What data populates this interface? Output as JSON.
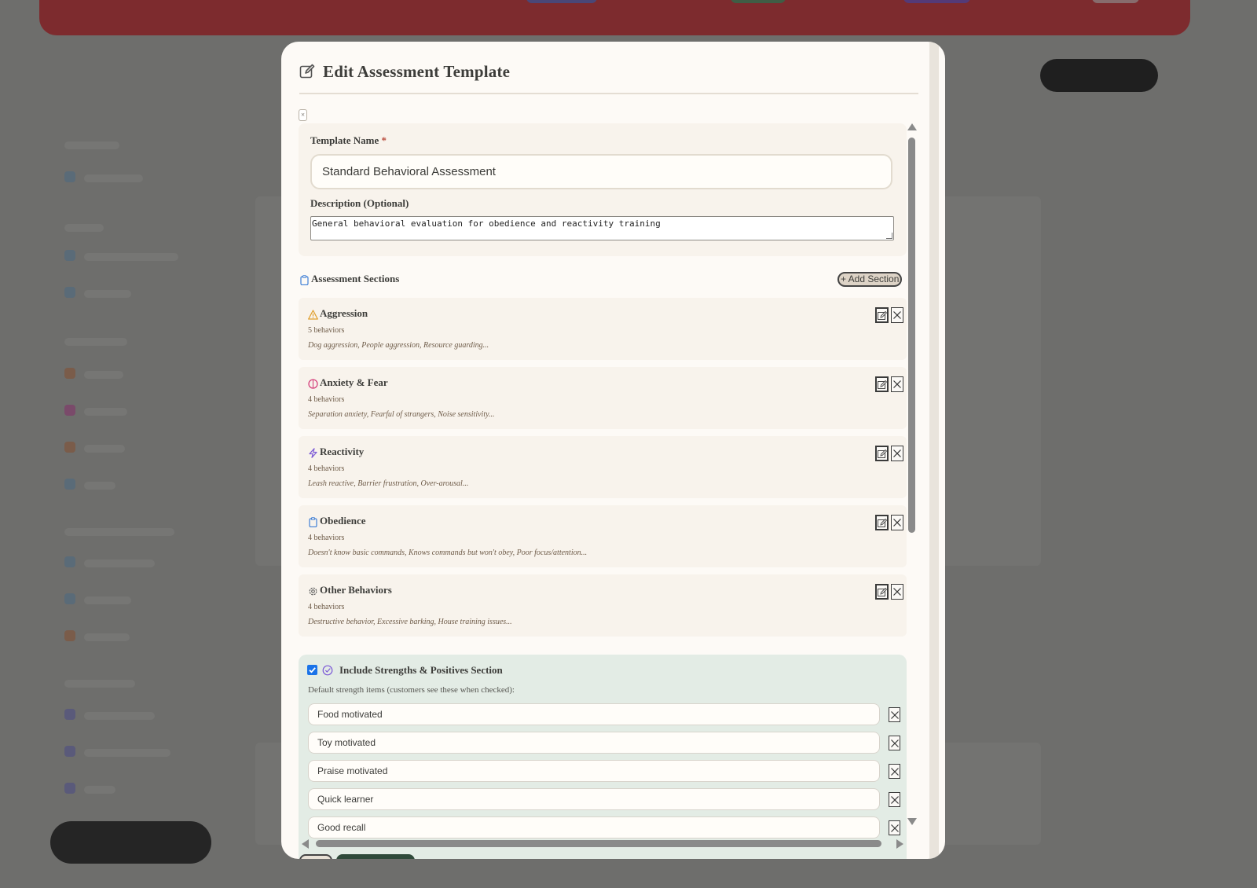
{
  "modal": {
    "title": "Edit Assessment Template",
    "close_label": "×"
  },
  "form": {
    "template_name_label": "Template Name",
    "required_mark": "*",
    "template_name_value": "Standard Behavioral Assessment",
    "description_label": "Description (Optional)",
    "description_value": "General behavioral evaluation for obedience and reactivity training"
  },
  "sections": {
    "title": "Assessment Sections",
    "add_button": "+ Add Section",
    "items": [
      {
        "name": "Aggression",
        "count": "5 behaviors",
        "preview": "Dog aggression, People aggression, Resource guarding...",
        "icon": "warning-icon",
        "color": "#e0a030"
      },
      {
        "name": "Anxiety & Fear",
        "count": "4 behaviors",
        "preview": "Separation anxiety, Fearful of strangers, Noise sensitivity...",
        "icon": "brain-icon",
        "color": "#d6457f"
      },
      {
        "name": "Reactivity",
        "count": "4 behaviors",
        "preview": "Leash reactive, Barrier frustration, Over-arousal...",
        "icon": "lightning-icon",
        "color": "#7c5ad6"
      },
      {
        "name": "Obedience",
        "count": "4 behaviors",
        "preview": "Doesn't know basic commands, Knows commands but won't obey, Poor focus/attention...",
        "icon": "clipboard-icon",
        "color": "#3f7fd6"
      },
      {
        "name": "Other Behaviors",
        "count": "4 behaviors",
        "preview": "Destructive behavior, Excessive barking, House training issues...",
        "icon": "gear-icon",
        "color": "#5a5a5a"
      }
    ]
  },
  "strengths": {
    "checked": true,
    "title": "Include Strengths & Positives Section",
    "subtitle": "Default strength items (customers see these when checked):",
    "items": [
      "Food motivated",
      "Toy motivated",
      "Praise motivated",
      "Quick learner",
      "Good recall"
    ]
  },
  "colors": {
    "accent": "#1a73e8",
    "modal_bg": "#fdfaf6",
    "card_bg": "#f8f3ec",
    "strengths_bg": "#e3ece5"
  }
}
